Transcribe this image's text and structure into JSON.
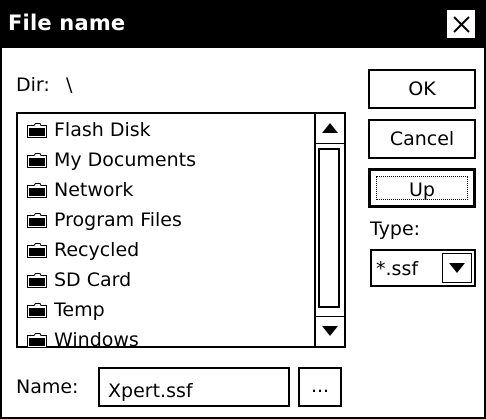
{
  "dialog": {
    "title": "File name",
    "close_icon": "close-icon"
  },
  "dir": {
    "label": "Dir:",
    "value": "\\"
  },
  "buttons": {
    "ok": "OK",
    "cancel": "Cancel",
    "up": "Up",
    "browse": "..."
  },
  "type": {
    "label": "Type:",
    "value": "*.ssf"
  },
  "folders": [
    "Flash Disk",
    "My Documents",
    "Network",
    "Program Files",
    "Recycled",
    "SD Card",
    "Temp",
    "Windows"
  ],
  "name": {
    "label": "Name:",
    "value": "Xpert.ssf"
  },
  "colors": {
    "titlebar_bg": "#000000",
    "titlebar_text": "#ffffff",
    "window_bg": "#ffffff"
  }
}
